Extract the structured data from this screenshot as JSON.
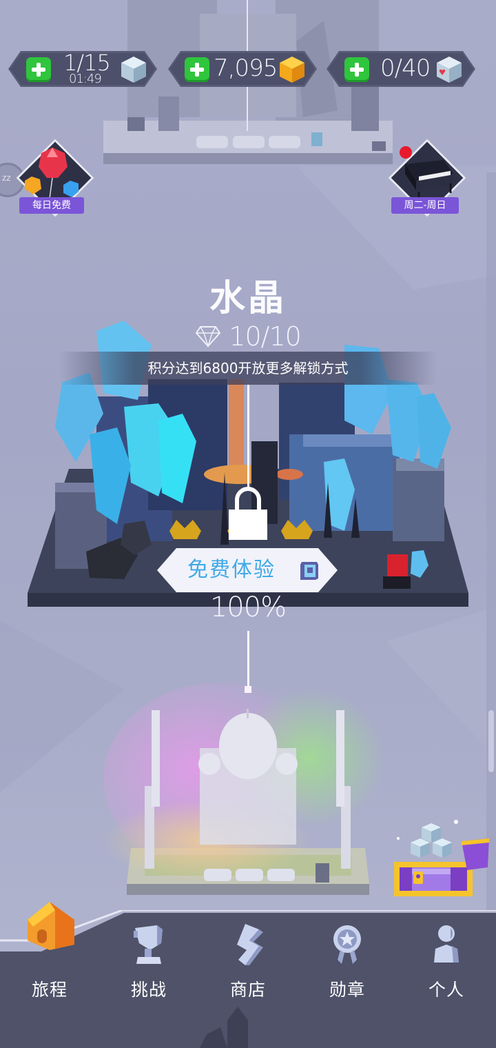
{
  "resources": {
    "energy": {
      "value": "1/15",
      "timer": "01:49",
      "icon": "ice-cube-icon"
    },
    "coins": {
      "value": "7,095",
      "icon": "gold-cube-icon"
    },
    "hearts": {
      "value": "0/40",
      "icon": "heart-cube-icon"
    }
  },
  "side_badges": {
    "daily_free": {
      "label": "每日免费",
      "icon": "gem-balloons-icon"
    },
    "weekly_event": {
      "label": "周二-周日",
      "icon": "piano-icon",
      "notification": true
    },
    "sleep_icon": "zzz-icon"
  },
  "level": {
    "title": "水晶",
    "gems": "10/10",
    "gem_icon": "diamond-outline-icon",
    "unlock_hint": "积分达到6800开放更多解锁方式",
    "lock_icon": "padlock-icon",
    "trial_button": "免费体验",
    "trial_icon": "ticket-icon",
    "progress": "100%"
  },
  "chest_icon": "treasure-chest-icon",
  "bottom_nav": {
    "items": [
      {
        "label": "旅程",
        "icon": "home-icon",
        "active": true
      },
      {
        "label": "挑战",
        "icon": "trophy-icon",
        "active": false
      },
      {
        "label": "商店",
        "icon": "store-icon",
        "active": false
      },
      {
        "label": "勋章",
        "icon": "medal-icon",
        "active": false
      },
      {
        "label": "个人",
        "icon": "person-icon",
        "active": false
      }
    ]
  },
  "colors": {
    "background": "#a6a9c7",
    "panel": "#4d506a",
    "plus_green": "#2fc53c",
    "accent_blue": "#3fa9e6",
    "badge_purple": "#7b55d8",
    "home_orange": "#f39c2c"
  }
}
